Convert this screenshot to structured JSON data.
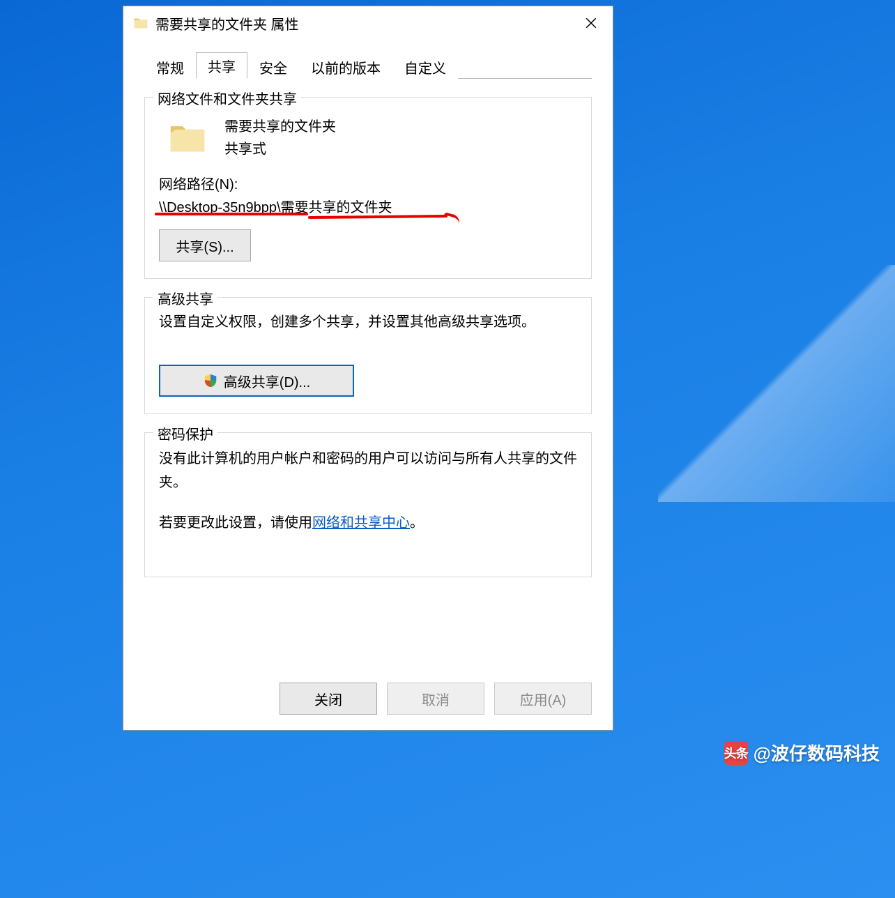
{
  "window": {
    "title": "需要共享的文件夹 属性",
    "tabs": [
      "常规",
      "共享",
      "安全",
      "以前的版本",
      "自定义"
    ],
    "active_tab_index": 1
  },
  "network_share": {
    "legend": "网络文件和文件夹共享",
    "folder_name": "需要共享的文件夹",
    "share_status": "共享式",
    "path_label": "网络路径(N):",
    "path_value": "\\\\Desktop-35n9bpp\\需要共享的文件夹",
    "share_button": "共享(S)..."
  },
  "advanced": {
    "legend": "高级共享",
    "description": "设置自定义权限，创建多个共享，并设置其他高级共享选项。",
    "button": "高级共享(D)..."
  },
  "password": {
    "legend": "密码保护",
    "text1": "没有此计算机的用户帐户和密码的用户可以访问与所有人共享的文件夹。",
    "text2_prefix": "若要更改此设置，请使用",
    "link": "网络和共享中心",
    "text2_suffix": "。"
  },
  "buttons": {
    "close": "关闭",
    "cancel": "取消",
    "apply": "应用(A)"
  },
  "watermark": {
    "badge": "头条",
    "text": "@波仔数码科技"
  }
}
